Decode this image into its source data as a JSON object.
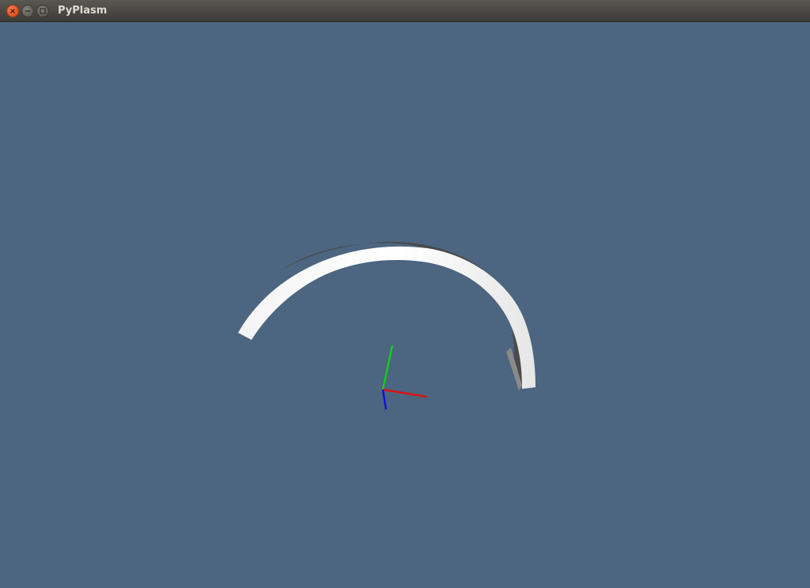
{
  "window": {
    "title": "PyPlasm"
  },
  "titlebar_buttons": {
    "close": "close-icon",
    "minimize": "minimize-icon",
    "maximize": "maximize-icon"
  },
  "viewport": {
    "background_color": "#4c6580"
  },
  "scene": {
    "object": "arc-ring",
    "object_color": "#ffffff",
    "axes": [
      {
        "name": "x-axis",
        "color": "#e01010"
      },
      {
        "name": "y-axis",
        "color": "#10d010"
      },
      {
        "name": "z-axis",
        "color": "#1010e0"
      }
    ]
  }
}
